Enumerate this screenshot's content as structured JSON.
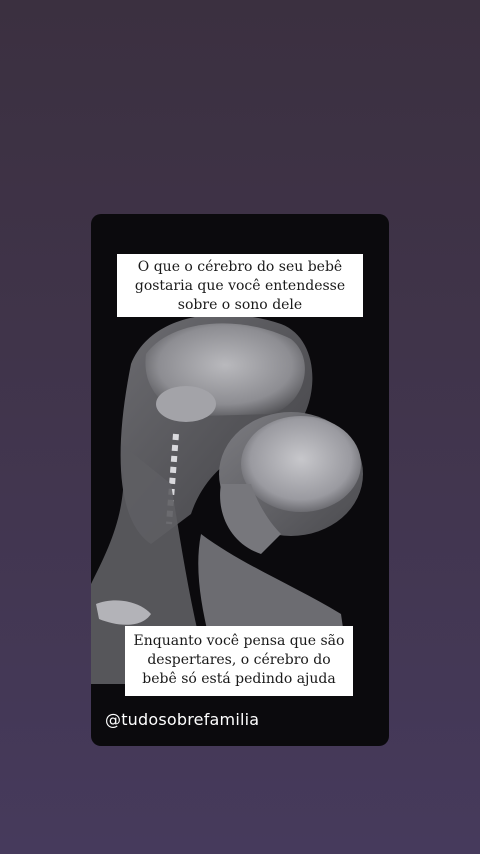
{
  "story": {
    "caption_top": "O que o cérebro do seu bebê gostaria que você entendesse sobre o sono dele",
    "caption_bottom": "Enquanto você pensa que são despertares, o cérebro do bebê só está pedindo ajuda",
    "handle": "@tudosobrefamilia"
  },
  "colors": {
    "background_top": "#3b3040",
    "background_bottom": "#463a5c",
    "card": "#0b0a0d",
    "caption_bg": "#ffffff"
  }
}
